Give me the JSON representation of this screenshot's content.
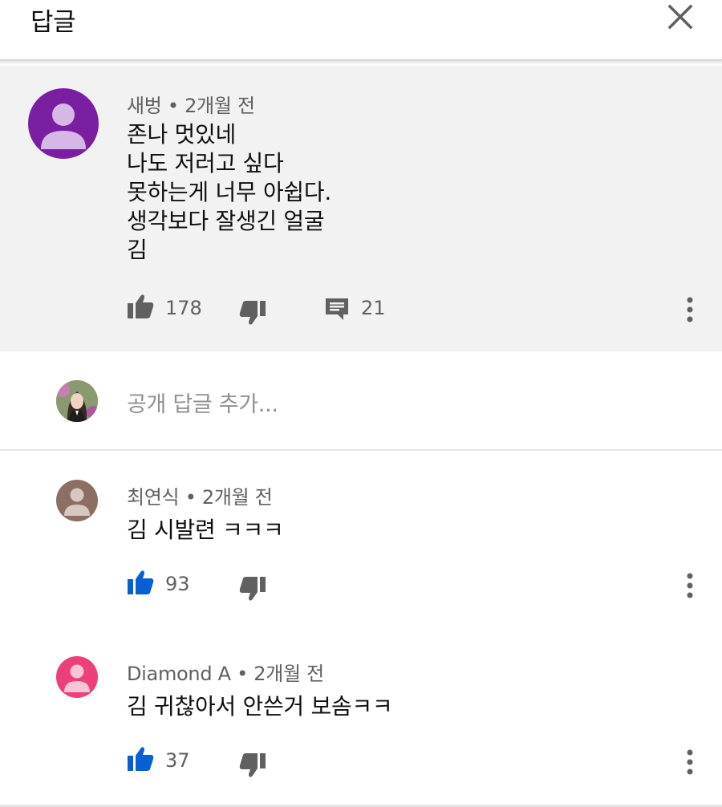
{
  "header": {
    "title": "답글",
    "close_icon": "close-icon"
  },
  "parent_comment": {
    "author": "새벙",
    "time": "2개월 전",
    "avatar_color": "#7b1fa2",
    "lines": [
      "존나 멋있네",
      "나도 저러고 싶다",
      "못하는게 너무 아쉽다.",
      "생각보다 잘생긴 얼굴",
      "김"
    ],
    "likes": "178",
    "replies": "21"
  },
  "reply_box": {
    "placeholder": "공개 답글 추가..."
  },
  "replies": [
    {
      "author": "최연식",
      "time": "2개월 전",
      "text": "김 시발련 ㅋㅋㅋ",
      "likes": "93",
      "avatar_color": "#8d6e63"
    },
    {
      "author": "Diamond A",
      "time": "2개월 전",
      "text": "김 귀찮아서 안쓴거 보솜ㅋㅋ",
      "likes": "37",
      "avatar_color": "#ec407a"
    }
  ],
  "colors": {
    "like_active": "#065fd4",
    "icon_gray": "#606060",
    "parent_bg": "#f2f2f2"
  }
}
